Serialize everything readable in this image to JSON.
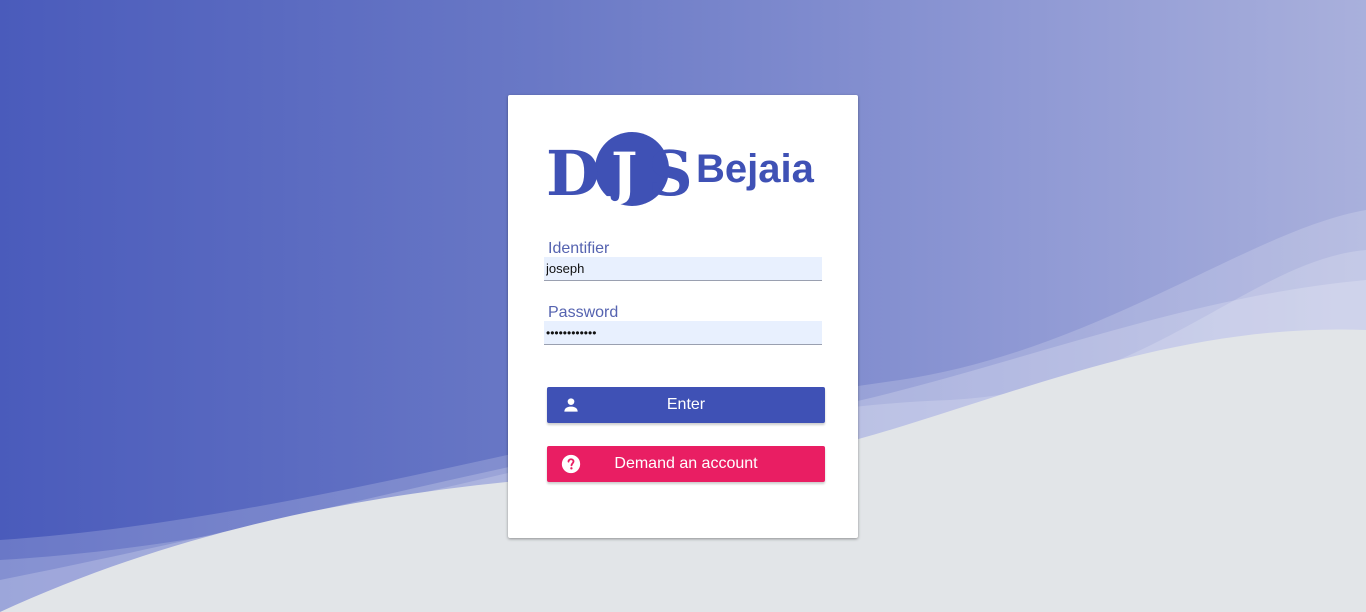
{
  "logo": {
    "mark_text": "DJS",
    "city_text": "Bejaia",
    "brand_color": "#3f51b5"
  },
  "login_form": {
    "identifier": {
      "label": "Identifier",
      "value": "joseph"
    },
    "password": {
      "label": "Password",
      "value": "••••••••••••"
    },
    "enter_button": {
      "label": "Enter",
      "icon": "person-icon",
      "color": "#3f51b5"
    },
    "demand_button": {
      "label": "Demand an account",
      "icon": "help-circle-icon",
      "color": "#e91e63"
    }
  }
}
